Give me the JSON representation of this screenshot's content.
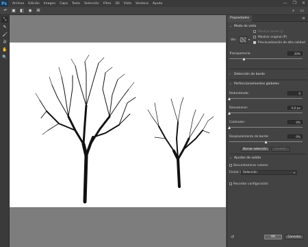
{
  "app": {
    "logo": "Ps"
  },
  "menu": [
    "Archivo",
    "Edición",
    "Imagen",
    "Capa",
    "Texto",
    "Selección",
    "Filtro",
    "3D",
    "Vista",
    "Ventana",
    "Ayuda"
  ],
  "window_controls": [
    "—",
    "❐",
    "✕"
  ],
  "options_icons": [
    "↶",
    "▣",
    "◧",
    "◉",
    "⌘"
  ],
  "options_right": [
    "⌕",
    "▭"
  ],
  "tools": [
    {
      "name": "quick-selection-tool-icon",
      "glyph": "⤡"
    },
    {
      "name": "refine-edge-brush-icon",
      "glyph": "✎"
    },
    {
      "name": "brush-tool-icon",
      "glyph": "🖌"
    },
    {
      "name": "lasso-tool-icon",
      "glyph": "ᘐ"
    },
    {
      "name": "hand-tool-icon",
      "glyph": "✋"
    },
    {
      "name": "zoom-tool-icon",
      "glyph": "🔍"
    }
  ],
  "panel": {
    "tab_label": "Propiedades",
    "view_mode": {
      "title": "Modo de vista",
      "view_label": "Ver:",
      "show_edge": "Mostrar borde (J)",
      "show_original": "Mostrar original (P)",
      "high_quality_preview": "Previsualización de alta calidad",
      "show_edge_checked": false,
      "show_original_checked": false,
      "high_quality_checked": true
    },
    "transparency": {
      "label": "Transparencia",
      "value": "20%",
      "fraction": 0.2
    },
    "edge_detection": {
      "title": "Detección de borde"
    },
    "global_refinements": {
      "title": "Perfeccionamientos globales",
      "smooth": {
        "label": "Redondeado:",
        "value": "0",
        "fraction": 0
      },
      "feather": {
        "label": "Desvanecer:",
        "value": "0,0 px",
        "fraction": 0
      },
      "contrast": {
        "label": "Contraste:",
        "value": "0%",
        "fraction": 0
      },
      "shift_edge": {
        "label": "Desplazamiento de borde:",
        "value": "0%",
        "fraction": 0.5
      },
      "clear_selection": "Borrar selección",
      "invert": "Invertir"
    },
    "output": {
      "title": "Ajustes de salida",
      "decontaminate": "Descontaminar colores",
      "decontaminate_checked": false,
      "output_to_label": "Enviar a:",
      "output_to_value": "Selección",
      "remember_settings": "Recordar configuración",
      "remember_checked": false
    },
    "reset_icon": "↺",
    "ok": "OK",
    "cancel": "Cancelar"
  }
}
